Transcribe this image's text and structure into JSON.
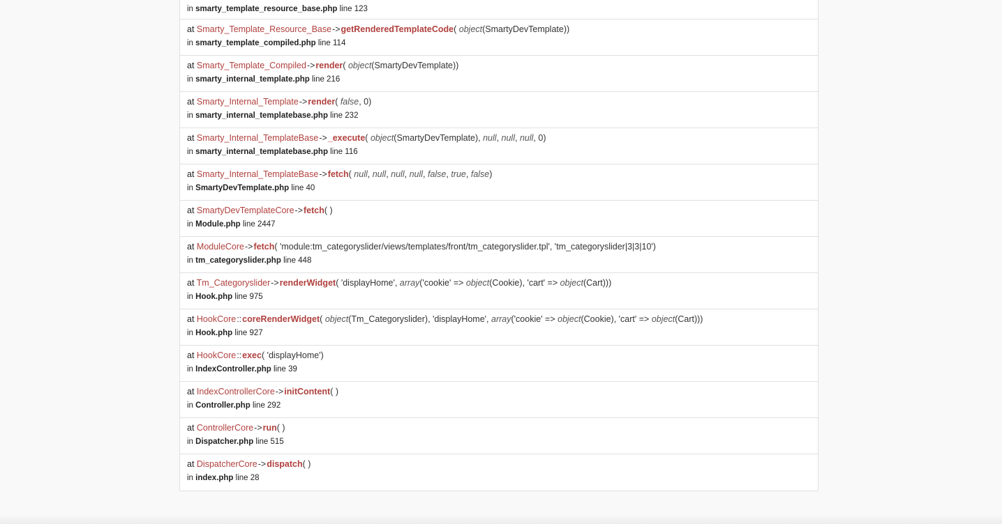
{
  "frames": [
    {
      "class": "",
      "type": "",
      "function": "",
      "args": "",
      "file": "smarty_template_resource_base.php",
      "line": "123"
    },
    {
      "class": "Smarty_Template_Resource_Base",
      "type": "->",
      "function": "getRenderedTemplateCode",
      "args_html": "<i>object</i>(SmartyDevTemplate)",
      "file": "smarty_template_compiled.php",
      "line": "114"
    },
    {
      "class": "Smarty_Template_Compiled",
      "type": "->",
      "function": "render",
      "args_html": "<i>object</i>(SmartyDevTemplate)",
      "file": "smarty_internal_template.php",
      "line": "216"
    },
    {
      "class": "Smarty_Internal_Template",
      "type": "->",
      "function": "render",
      "args_html": "<i>false</i>, 0",
      "file": "smarty_internal_templatebase.php",
      "line": "232"
    },
    {
      "class": "Smarty_Internal_TemplateBase",
      "type": "->",
      "function": "_execute",
      "args_html": "<i>object</i>(SmartyDevTemplate), <i>null</i>, <i>null</i>, <i>null</i>, 0",
      "file": "smarty_internal_templatebase.php",
      "line": "116"
    },
    {
      "class": "Smarty_Internal_TemplateBase",
      "type": "->",
      "function": "fetch",
      "args_html": "<i>null</i>, <i>null</i>, <i>null</i>, <i>null</i>, <i>false</i>, <i>true</i>, <i>false</i>",
      "file": "SmartyDevTemplate.php",
      "line": "40"
    },
    {
      "class": "SmartyDevTemplateCore",
      "type": "->",
      "function": "fetch",
      "args_html": "",
      "file": "Module.php",
      "line": "2447"
    },
    {
      "class": "ModuleCore",
      "type": "->",
      "function": "fetch",
      "args_html": "'module:tm_categoryslider/views/templates/front/tm_categoryslider.tpl', 'tm_categoryslider|3|3|10'",
      "file": "tm_categoryslider.php",
      "line": "448"
    },
    {
      "class": "Tm_Categoryslider",
      "type": "->",
      "function": "renderWidget",
      "args_html": "'displayHome', <i>array</i>('cookie' =&gt; <i>object</i>(Cookie), 'cart' =&gt; <i>object</i>(Cart))",
      "file": "Hook.php",
      "line": "975"
    },
    {
      "class": "HookCore",
      "type": "::",
      "function": "coreRenderWidget",
      "args_html": "<i>object</i>(Tm_Categoryslider), 'displayHome', <i>array</i>('cookie' =&gt; <i>object</i>(Cookie), 'cart' =&gt; <i>object</i>(Cart))",
      "file": "Hook.php",
      "line": "927"
    },
    {
      "class": "HookCore",
      "type": "::",
      "function": "exec",
      "args_html": "'displayHome'",
      "file": "IndexController.php",
      "line": "39"
    },
    {
      "class": "IndexControllerCore",
      "type": "->",
      "function": "initContent",
      "args_html": "",
      "file": "Controller.php",
      "line": "292"
    },
    {
      "class": "ControllerCore",
      "type": "->",
      "function": "run",
      "args_html": "",
      "file": "Dispatcher.php",
      "line": "515"
    },
    {
      "class": "DispatcherCore",
      "type": "->",
      "function": "dispatch",
      "args_html": "",
      "file": "index.php",
      "line": "28"
    }
  ],
  "labels": {
    "at": "at",
    "in": "in",
    "line": "line"
  },
  "colors": {
    "class": "#b0413e",
    "function": "#b0413e",
    "border": "#e0e0e0",
    "background": "#f9f9f9"
  }
}
